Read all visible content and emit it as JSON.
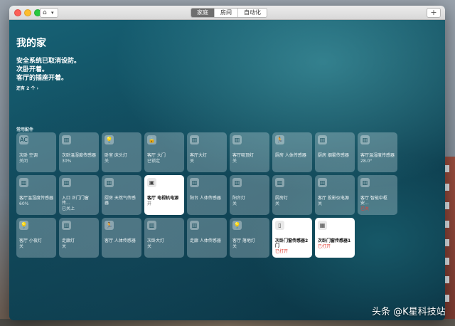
{
  "toolbar": {
    "tabs": [
      "家庭",
      "房间",
      "自动化"
    ],
    "active_tab": "家庭",
    "add": "+"
  },
  "home": {
    "title": "我的家",
    "status": [
      "安全系统已取消设防。",
      "次卧开着。",
      "客厅的插座开着。"
    ],
    "more": "还有 2 个 ›",
    "section": "常用配件"
  },
  "tiles": [
    {
      "icon": "AC",
      "name": "次卧 空调",
      "status": "关闭",
      "active": false
    },
    {
      "icon": "▥",
      "name": "次卧温湿度传感器",
      "status": "30%",
      "active": false
    },
    {
      "icon": "💡",
      "name": "卧室 床头灯",
      "status": "关",
      "active": false
    },
    {
      "icon": "🔒",
      "name": "客厅 大门",
      "status": "已锁定",
      "active": false
    },
    {
      "icon": "▥",
      "name": "客厅大灯",
      "status": "关",
      "active": false
    },
    {
      "icon": "▥",
      "name": "客厅吸顶灯",
      "status": "关",
      "active": false
    },
    {
      "icon": "🏃",
      "name": "厨房 人体传感器",
      "status": "",
      "active": false
    },
    {
      "icon": "▥",
      "name": "厨房 烟雾传感器",
      "status": "",
      "active": false
    },
    {
      "icon": "▥",
      "name": "客厅温湿度传感器",
      "status": "28.0°",
      "active": false
    },
    {
      "icon": "▥",
      "name": "客厅温湿度传感器",
      "status": "60%",
      "active": false
    },
    {
      "icon": "▥",
      "name": "入口 正门门窗传...",
      "status": "已关上",
      "active": false
    },
    {
      "icon": "▥",
      "name": "厨房 天然气传感器",
      "status": "",
      "active": false
    },
    {
      "icon": "▣",
      "name": "客厅 电视机电源",
      "status": "开",
      "active": true
    },
    {
      "icon": "▥",
      "name": "阳台 人体传感器",
      "status": "",
      "active": false
    },
    {
      "icon": "▥",
      "name": "阳台灯",
      "status": "关",
      "active": false
    },
    {
      "icon": "▥",
      "name": "厨房灯",
      "status": "关",
      "active": false
    },
    {
      "icon": "▥",
      "name": "客厅 投影仪电源",
      "status": "关",
      "active": false
    },
    {
      "icon": "▥",
      "name": "客厅 智能中枢安...",
      "status": "已关",
      "status_alert": true,
      "active": false
    },
    {
      "icon": "💡",
      "name": "客厅 小夜灯",
      "status": "关",
      "active": false
    },
    {
      "icon": "▥",
      "name": "走廊灯",
      "status": "关",
      "active": false
    },
    {
      "icon": "🏃",
      "name": "客厅 人体传感器",
      "status": "",
      "active": false
    },
    {
      "icon": "▥",
      "name": "次卧大灯",
      "status": "关",
      "active": false
    },
    {
      "icon": "▥",
      "name": "走廊 人体传感器",
      "status": "",
      "active": false
    },
    {
      "icon": "💡",
      "name": "客厅 落地灯",
      "status": "关",
      "active": false
    },
    {
      "icon": "▯",
      "name": "次卧门窗传感器2门",
      "status": "已打开",
      "status_alert": true,
      "active": true
    },
    {
      "icon": "▦",
      "name": "次卧门窗传感器1",
      "status": "已打开",
      "status_alert": true,
      "active": true
    }
  ],
  "watermark": "头条 @K星科技站"
}
